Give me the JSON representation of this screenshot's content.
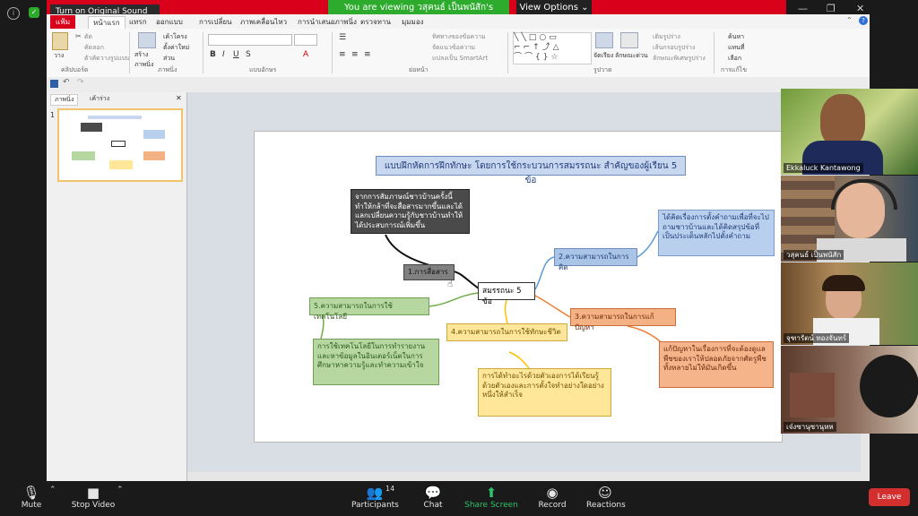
{
  "zoom": {
    "banner_text": "You are viewing วสุคนธ์ เป็นพนัสัก's screen",
    "view_options": "View Options",
    "original_sound": "Turn on Original Sound",
    "participants_count": "14",
    "toolbar": {
      "mute": "Mute",
      "stop_video": "Stop Video",
      "participants": "Participants",
      "chat": "Chat",
      "share_screen": "Share Screen",
      "record": "Record",
      "reactions": "Reactions",
      "leave": "Leave"
    },
    "participants": [
      {
        "name": "Ekkaluck Kantawong"
      },
      {
        "name": "วสุคนธ์ เป็นพนัสัก"
      },
      {
        "name": "จุฑารัตน์ ทองจันทร์"
      },
      {
        "name": "เจ๋งซานุซานุหห"
      }
    ]
  },
  "powerpoint": {
    "tabs": [
      "แฟ้ม",
      "หน้าแรก",
      "แทรก",
      "ออกแบบ",
      "การเปลี่ยน",
      "ภาพเคลื่อนไหว",
      "การนำเสนอภาพนิ่ง",
      "ตรวจทาน",
      "มุมมอง"
    ],
    "ribbon_groups": [
      "คลิปบอร์ด",
      "ภาพนิ่ง",
      "แบบอักษร",
      "ย่อหน้า",
      "รูปวาด",
      "การแก้ไข"
    ],
    "ribbon_items": {
      "paste": "วาง",
      "cut": "ตัด",
      "copy": "คัดลอก",
      "format_painter": "ตัวคัดวางรูปแบบ",
      "new_slide": "สร้างภาพนิ่ง",
      "layout": "เค้าโครง",
      "reset": "ตั้งค่าใหม่",
      "section": "ส่วน",
      "text_direction": "ทิศทางของข้อความ",
      "align_text": "จัดแนวข้อความ",
      "convert_smartart": "แปลงเป็น SmartArt",
      "arrange": "จัดเรียง",
      "quick_styles": "ลักษณะด่วน",
      "shape_fill": "เติมรูปร่าง",
      "shape_outline": "เส้นกรอบรูปร่าง",
      "shape_effects": "ลักษณะพิเศษรูปร่าง",
      "find": "ค้นหา",
      "replace": "แทนที่",
      "select": "เลือก"
    },
    "pane_tabs": [
      "ภาพนิ่ง",
      "เค้าร่าง"
    ],
    "slide_number": "1"
  },
  "slide": {
    "title": "แบบฝึกหัดการฝึกทักษะ โดยการใช้กระบวนการสมรรถนะ สำคัญของผู้เรียน 5 ข้อ",
    "info": "จากการสัมภาษณ์ชาวบ้านครั้งนี้ทำให้กล้าที่จะสื่อสารมากขึ้นและได้แลกเปลี่ยนความรู้กับชาวบ้านทำให้ได้ประสบการณ์เพิ่มขึ้น",
    "communication": "1.การสื่อสาร",
    "center": "สมรรถนะ 5 ข้อ",
    "thinking": "2.ความสามารถในการคิด",
    "thinking_desc": "ได้คิดเรื่องการตั้งคำถามเพื่อที่จะไปถามชาวบ้านและได้คิดสรุปข้อที่เป็นประเด็นหลักไปตั้งคำถาม",
    "technology": "5.ความสามารถในการใช้เทคโนโลยี",
    "technology_desc": "การใช้เทคโนโลยีในการทำรายงานและหาข้อมูลในอินเตอร์เน็ตในการศึกษาหาความรู้และทำความเข้าใจ",
    "problem": "3.ความสามารถในการแก้ปัญหา",
    "problem_desc": "แก้ปัญหาในเรื่องการที่จะต้องดูแลพืชของเราให้ปลอดภัยจากศัตรูพืชทั้งหลายไม่ให้มันเกิดขึ้น",
    "life": "4.ความสามารถในการใช้ทักษะชีวิต",
    "life_desc": "การได้ทำอะไรด้วยตัวเองการได้เรียนรู้ด้วยตัวเองและการตั้งใจทำอย่างใดอย่างหนึ่งให้สำเร็จ"
  },
  "colors": {
    "zoom_green": "#2dab2d",
    "ppt_red": "#d9001b",
    "leave_red": "#d32f2f"
  }
}
